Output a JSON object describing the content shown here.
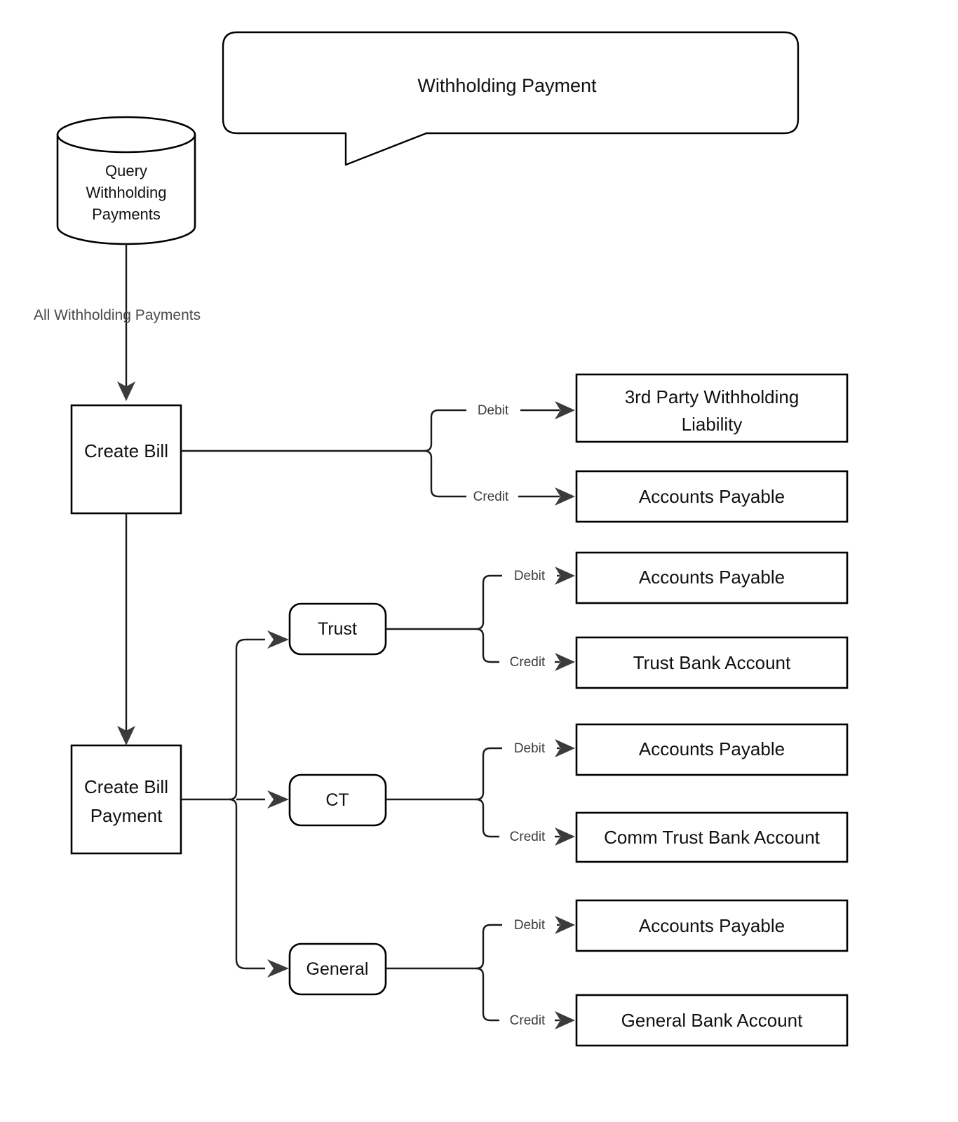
{
  "diagram": {
    "title_callout": {
      "text": "Withholding Payment",
      "shape": "speech-bubble"
    },
    "datastore": {
      "label_line1": "Query",
      "label_line2": "Withholding",
      "label_line3": "Payments",
      "shape": "cylinder"
    },
    "main_edge_label": "All Withholding Payments",
    "process_nodes": {
      "create_bill": "Create Bill",
      "create_bill_payment_line1": "Create Bill",
      "create_bill_payment_line2": "Payment"
    },
    "branch_nodes": [
      {
        "label": "Trust"
      },
      {
        "label": "CT"
      },
      {
        "label": "General"
      }
    ],
    "edge_labels": {
      "debit": "Debit",
      "credit": "Credit"
    },
    "accounts": {
      "bill_debit_line1": "3rd Party Withholding",
      "bill_debit_line2": "Liability",
      "bill_credit": "Accounts Payable",
      "trust_debit": "Accounts Payable",
      "trust_credit": "Trust Bank Account",
      "ct_debit": "Accounts Payable",
      "ct_credit": "Comm Trust Bank Account",
      "general_debit": "Accounts Payable",
      "general_credit": "General Bank Account"
    },
    "colors": {
      "stroke": "#000000",
      "connector": "#1a1a1a",
      "arrow_fill": "#3b3b3b",
      "edge_text": "#3d3d3d",
      "background": "#ffffff"
    }
  }
}
